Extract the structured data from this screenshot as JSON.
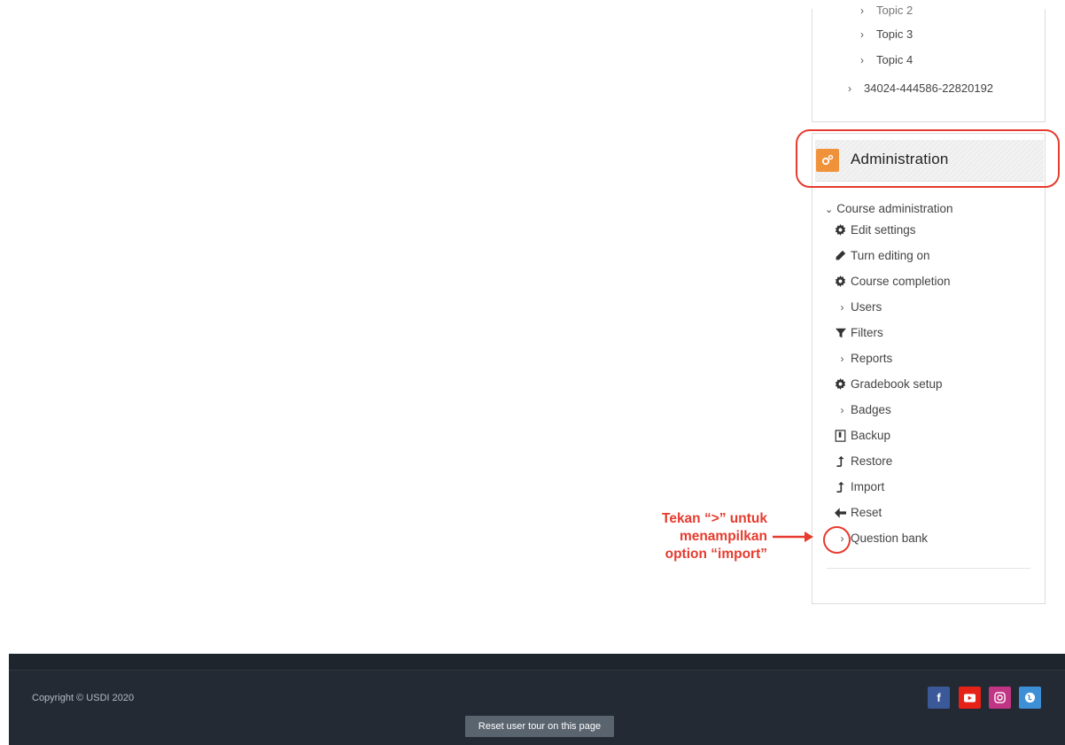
{
  "navigation": {
    "items": [
      {
        "label": "Topic 2"
      },
      {
        "label": "Topic 3"
      },
      {
        "label": "Topic 4"
      },
      {
        "label": "34024-444586-22820192"
      }
    ]
  },
  "administration": {
    "title": "Administration",
    "section_label": "Course administration",
    "items": [
      {
        "label": "Edit settings",
        "icon": "gear-icon"
      },
      {
        "label": "Turn editing on",
        "icon": "pencil-icon"
      },
      {
        "label": "Course completion",
        "icon": "gear-icon"
      },
      {
        "label": "Users",
        "icon": "chevron-right-icon"
      },
      {
        "label": "Filters",
        "icon": "filter-icon"
      },
      {
        "label": "Reports",
        "icon": "chevron-right-icon"
      },
      {
        "label": "Gradebook setup",
        "icon": "gear-icon"
      },
      {
        "label": "Badges",
        "icon": "chevron-right-icon"
      },
      {
        "label": "Backup",
        "icon": "file-icon"
      },
      {
        "label": "Restore",
        "icon": "upload-icon"
      },
      {
        "label": "Import",
        "icon": "upload-icon"
      },
      {
        "label": "Reset",
        "icon": "arrow-left-icon"
      },
      {
        "label": "Question bank",
        "icon": "chevron-right-icon"
      }
    ]
  },
  "annotation": {
    "line1": "Tekan “>” untuk",
    "line2": "menampilkan",
    "line3": "option “import”",
    "color": "#e63b2e"
  },
  "footer": {
    "copyright": "Copyright © USDI 2020",
    "tour_button": "Reset user tour on this page",
    "social": [
      {
        "name": "facebook",
        "glyph": "f",
        "color": "#3b5998"
      },
      {
        "name": "youtube",
        "glyph": "▶",
        "color": "#e62117"
      },
      {
        "name": "instagram",
        "glyph": "◎",
        "color": "#c13584"
      },
      {
        "name": "website",
        "glyph": "◉",
        "color": "#3d8fd6"
      }
    ]
  }
}
